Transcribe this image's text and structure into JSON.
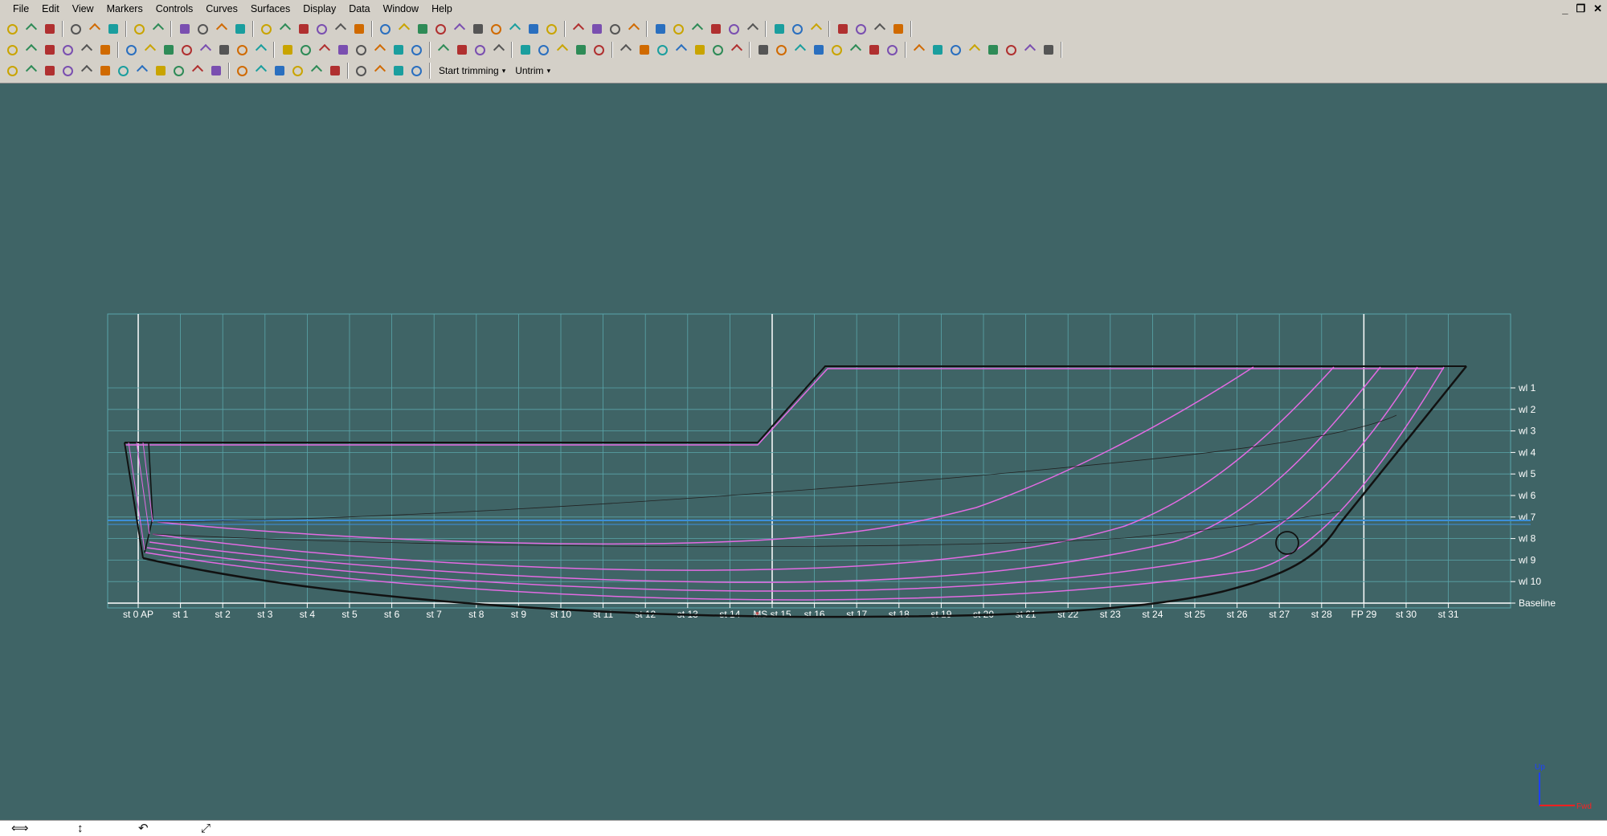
{
  "menu": [
    "File",
    "Edit",
    "View",
    "Markers",
    "Controls",
    "Curves",
    "Surfaces",
    "Display",
    "Data",
    "Window",
    "Help"
  ],
  "window_controls": {
    "minimize": "_",
    "restore": "❐",
    "close": "✕"
  },
  "toolbar": {
    "start_trimming": "Start trimming",
    "untrim": "Untrim"
  },
  "view": {
    "stations": [
      "st 0 AP",
      "st 1",
      "st 2",
      "st 3",
      "st 4",
      "st 5",
      "st 6",
      "st 7",
      "st 8",
      "st 9",
      "st 10",
      "st 11",
      "st 12",
      "st 13",
      "st 14",
      "MS st 15",
      "st 16",
      "st 17",
      "st 18",
      "st 19",
      "st 20",
      "st 21",
      "st 22",
      "st 23",
      "st 24",
      "st 25",
      "st 26",
      "st 27",
      "st 28",
      "FP 29",
      "st 30",
      "st 31"
    ],
    "waterlines": [
      "wl 1",
      "wl 2",
      "wl 3",
      "wl 4",
      "wl 5",
      "wl 6",
      "wl 7",
      "wl 8",
      "wl 9",
      "wl 10",
      "Baseline"
    ],
    "axis_up": "Up",
    "axis_fwd": "Fwd",
    "colors": {
      "background": "#3f6466",
      "grid": "#5aa5aa",
      "buttock": "#e36be3",
      "hull": "#111111",
      "waterline_blue": "#3c8fd9"
    }
  },
  "statusbar": {
    "icons": [
      "pan-horizontal-icon",
      "pan-vertical-icon",
      "rotate-icon",
      "zoom-extents-icon"
    ]
  }
}
